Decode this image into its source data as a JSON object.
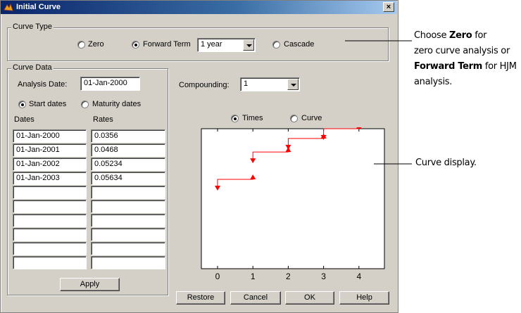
{
  "window": {
    "title": "Initial Curve",
    "close_glyph": "×"
  },
  "curve_type": {
    "label": "Curve Type",
    "options": [
      "Zero",
      "Forward Term",
      "Cascade"
    ],
    "selected": "Forward Term",
    "term_value": "1 year"
  },
  "curve_data": {
    "label": "Curve Data",
    "analysis_date_label": "Analysis Date:",
    "analysis_date": "01-Jan-2000",
    "date_modes": [
      "Start dates",
      "Maturity dates"
    ],
    "selected_mode": "Start dates",
    "col_dates": "Dates",
    "col_rates": "Rates",
    "rows": [
      [
        "01-Jan-2000",
        "0.0356"
      ],
      [
        "01-Jan-2001",
        "0.0468"
      ],
      [
        "01-Jan-2002",
        "0.05234"
      ],
      [
        "01-Jan-2003",
        "0.05634"
      ],
      [
        "",
        ""
      ],
      [
        "",
        ""
      ],
      [
        "",
        ""
      ],
      [
        "",
        ""
      ],
      [
        "",
        ""
      ],
      [
        "",
        ""
      ]
    ],
    "apply_label": "Apply"
  },
  "compounding": {
    "label": "Compounding:",
    "value": "1"
  },
  "display": {
    "options": [
      "Times",
      "Curve"
    ],
    "selected": "Times"
  },
  "chart_data": {
    "type": "line",
    "x_ticks": [
      "0",
      "1",
      "2",
      "3",
      "4"
    ],
    "xlim": [
      0,
      4
    ],
    "ylim": [
      0.0356,
      0.05634
    ],
    "segments": [
      {
        "start": 0,
        "end": 1,
        "rate": 0.0356
      },
      {
        "start": 1,
        "end": 2,
        "rate": 0.0468
      },
      {
        "start": 2,
        "end": 3,
        "rate": 0.05234
      },
      {
        "start": 3,
        "end": 4,
        "rate": 0.05634
      }
    ],
    "line_color": "#ff0000"
  },
  "buttons": {
    "restore": "Restore",
    "cancel": "Cancel",
    "ok": "OK",
    "help": "Help"
  },
  "annotations": {
    "curve_type_note": {
      "l1_pre": "Choose ",
      "l1_bold": "Zero",
      "l1_post": " for",
      "l2": "zero curve analysis or",
      "l3_bold": "Forward Term",
      "l3_post": " for HJM",
      "l4": "analysis."
    },
    "display_note": "Curve display."
  }
}
